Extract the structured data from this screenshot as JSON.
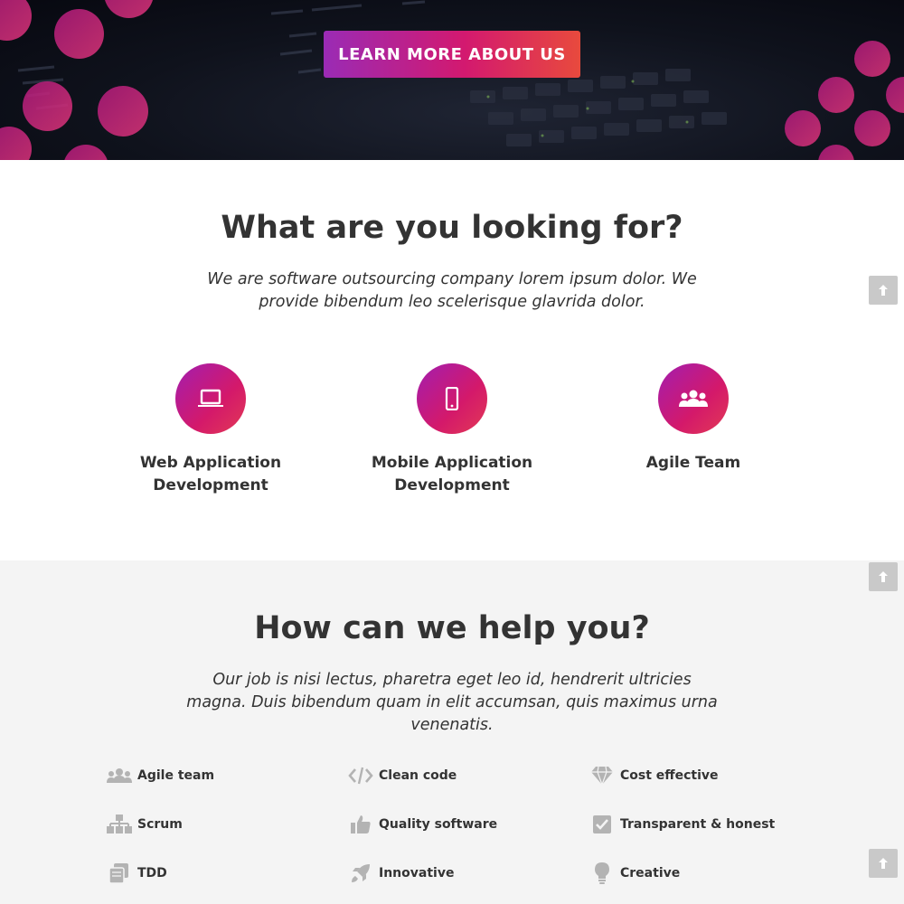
{
  "hero": {
    "cta_label": "LEARN MORE ABOUT US"
  },
  "section_looking": {
    "title": "What are you looking for?",
    "lead": "We are software outsourcing company lorem ipsum dolor. We provide bibendum leo scelerisque glavrida dolor.",
    "features": [
      {
        "icon": "laptop-icon",
        "label": "Web Application\nDevelopment"
      },
      {
        "icon": "mobile-icon",
        "label": "Mobile Application\nDevelopment"
      },
      {
        "icon": "users-icon",
        "label": "Agile Team"
      }
    ]
  },
  "section_help": {
    "title": "How can we help you?",
    "lead": "Our job is nisi lectus, pharetra eget leo id, hendrerit ultricies magna. Duis bibendum quam in elit accumsan, quis maximus urna venenatis.",
    "items": [
      {
        "icon": "users-icon",
        "label": "Agile team"
      },
      {
        "icon": "code-icon",
        "label": "Clean code"
      },
      {
        "icon": "diamond-icon",
        "label": "Cost effective"
      },
      {
        "icon": "sitemap-icon",
        "label": "Scrum"
      },
      {
        "icon": "thumbs-up-icon",
        "label": "Quality software"
      },
      {
        "icon": "checkbox-icon",
        "label": "Transparent & honest"
      },
      {
        "icon": "copy-icon",
        "label": "TDD"
      },
      {
        "icon": "rocket-icon",
        "label": "Innovative"
      },
      {
        "icon": "lightbulb-icon",
        "label": "Creative"
      }
    ]
  },
  "colors": {
    "accent_start": "#9a2bb5",
    "accent_mid": "#d3196f",
    "accent_end": "#e84a3d",
    "icon_gray": "#b3b3b3",
    "section_gray": "#f4f4f4"
  }
}
